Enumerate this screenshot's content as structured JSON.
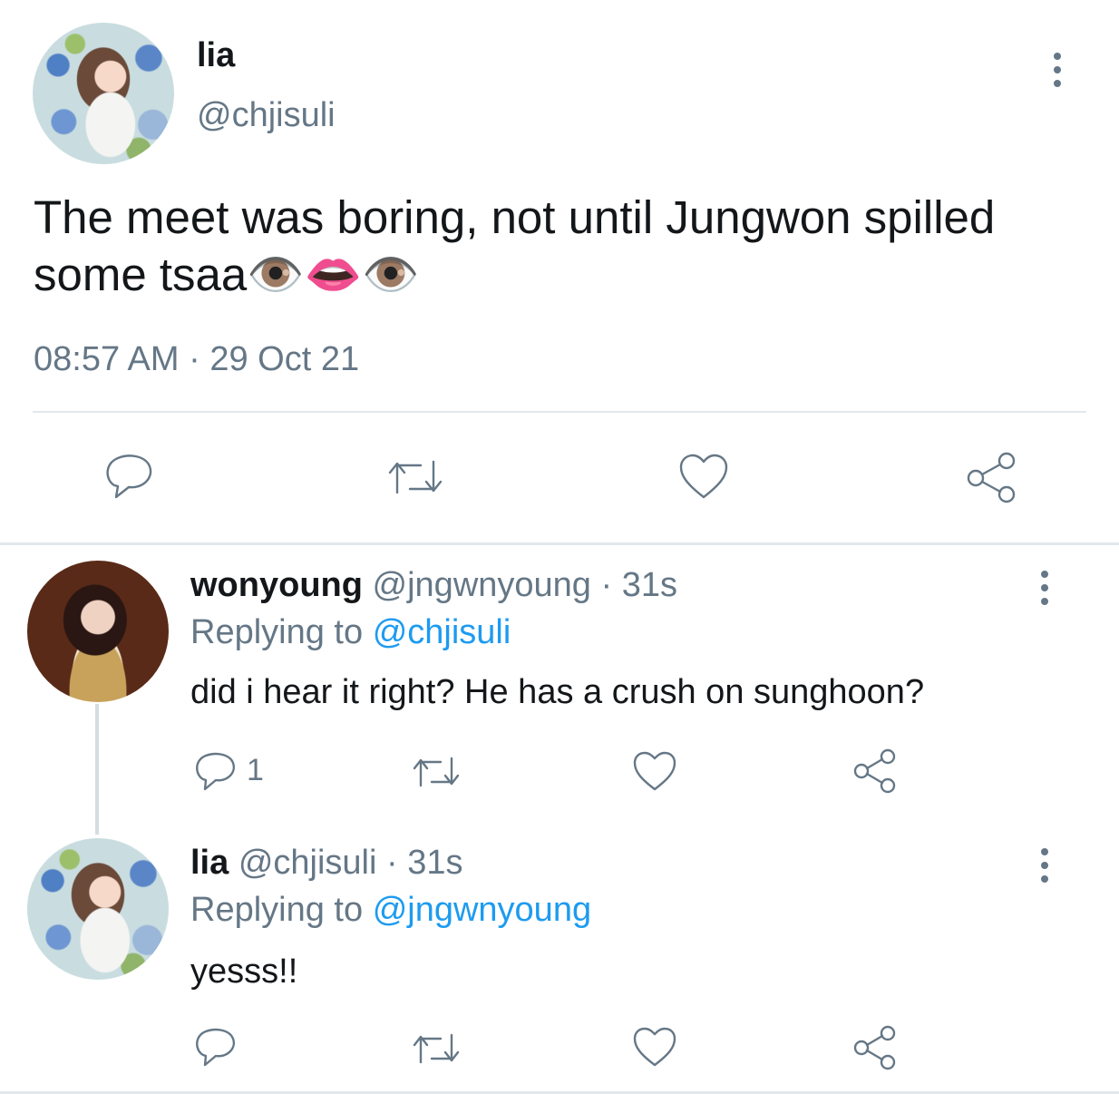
{
  "main_tweet": {
    "display_name": "lia",
    "handle": "@chjisuli",
    "text": "The meet was boring, not until Jungwon spilled some tsaa👁️👄👁️",
    "timestamp": "08:57 AM · 29 Oct 21",
    "actions": [
      "reply-icon",
      "retweet-icon",
      "like-icon",
      "share-icon"
    ]
  },
  "replies": [
    {
      "display_name": "wonyoung",
      "handle": "@jngwnyoung",
      "time": "· 31s",
      "replying_prefix": "Replying to",
      "replying_to": "@chjisuli",
      "text": "did i hear it right? He has a crush on sunghoon?",
      "reply_count": "1"
    },
    {
      "display_name": "lia",
      "handle": "@chjisuli",
      "time": "· 31s",
      "replying_prefix": "Replying to",
      "replying_to": "@jngwnyoung",
      "text": "yesss!!",
      "reply_count": ""
    }
  ],
  "colors": {
    "text": "#14171a",
    "secondary": "#657786",
    "link": "#1d9bf0",
    "divider": "#e1e8ed"
  }
}
